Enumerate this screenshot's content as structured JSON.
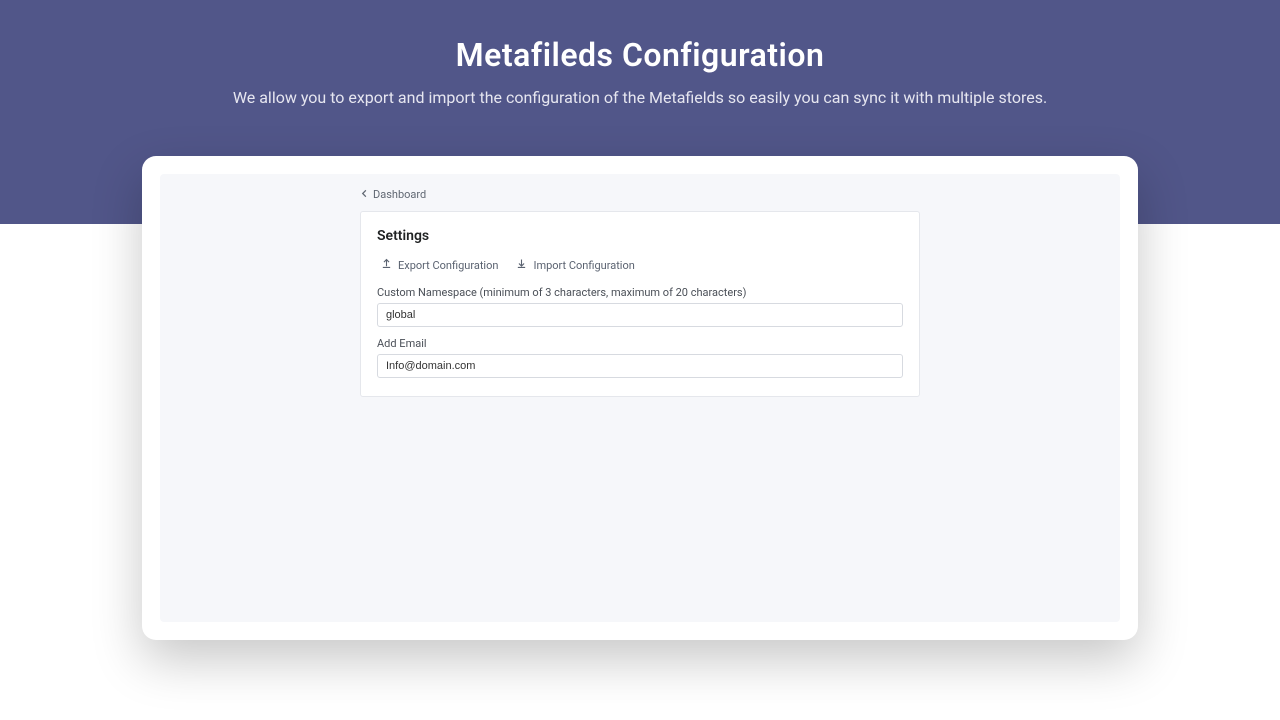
{
  "hero": {
    "title": "Metafileds Configuration",
    "subtitle": "We allow you to export and import the configuration of the Metafields so easily you can sync it with multiple stores."
  },
  "breadcrumb": {
    "label": "Dashboard"
  },
  "panel": {
    "heading": "Settings",
    "actions": {
      "export_label": "Export Configuration",
      "import_label": "Import Configuration"
    },
    "namespace": {
      "label": "Custom Namespace (minimum of 3 characters, maximum of 20 characters)",
      "value": "global"
    },
    "email": {
      "label": "Add Email",
      "value": "Info@domain.com"
    }
  }
}
